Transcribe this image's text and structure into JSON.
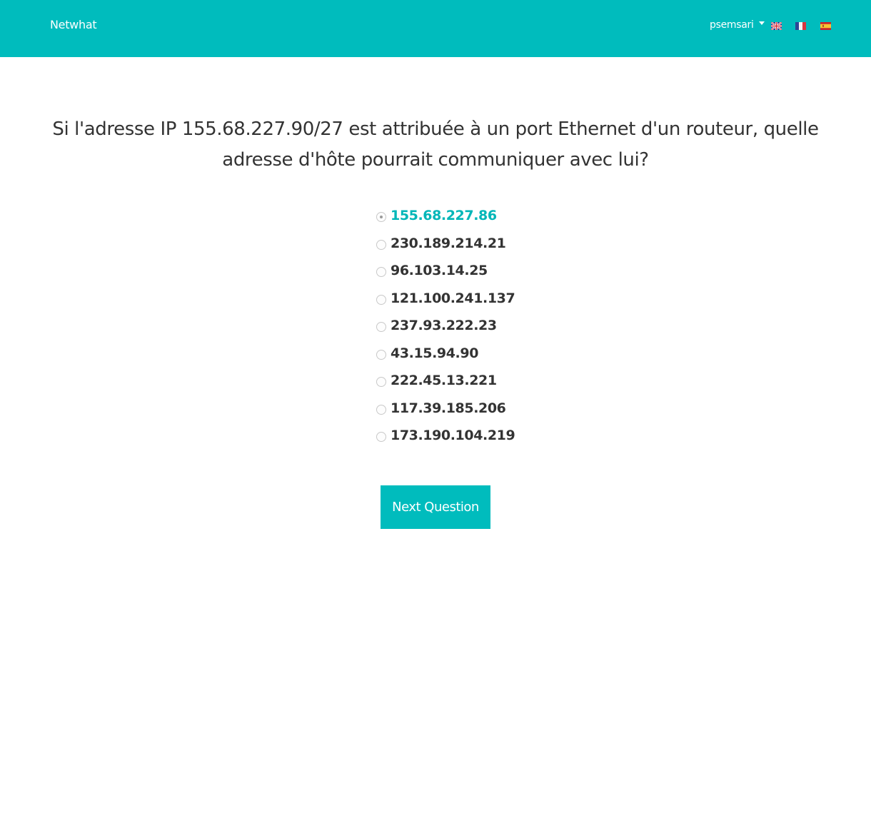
{
  "navbar": {
    "brand": "Netwhat",
    "username": "psemsari",
    "languages": [
      {
        "code": "en",
        "icon": "uk-flag-icon"
      },
      {
        "code": "fr",
        "icon": "france-flag-icon"
      },
      {
        "code": "es",
        "icon": "spain-flag-icon"
      }
    ],
    "color": "#00bcbd"
  },
  "quiz": {
    "question_line1": "Si l'adresse IP 155.68.227.90/27 est attribuée à un port Ethernet d'un routeur, quelle",
    "question_line2": "adresse d'hôte pourrait communiquer avec lui?",
    "options": [
      {
        "label": "155.68.227.86",
        "selected": true
      },
      {
        "label": "230.189.214.21",
        "selected": false
      },
      {
        "label": "96.103.14.25",
        "selected": false
      },
      {
        "label": "121.100.241.137",
        "selected": false
      },
      {
        "label": "237.93.222.23",
        "selected": false
      },
      {
        "label": "43.15.94.90",
        "selected": false
      },
      {
        "label": "222.45.13.221",
        "selected": false
      },
      {
        "label": "117.39.185.206",
        "selected": false
      },
      {
        "label": "173.190.104.219",
        "selected": false
      }
    ],
    "next_label": "Next Question",
    "accent_color": "#00b6b8"
  }
}
